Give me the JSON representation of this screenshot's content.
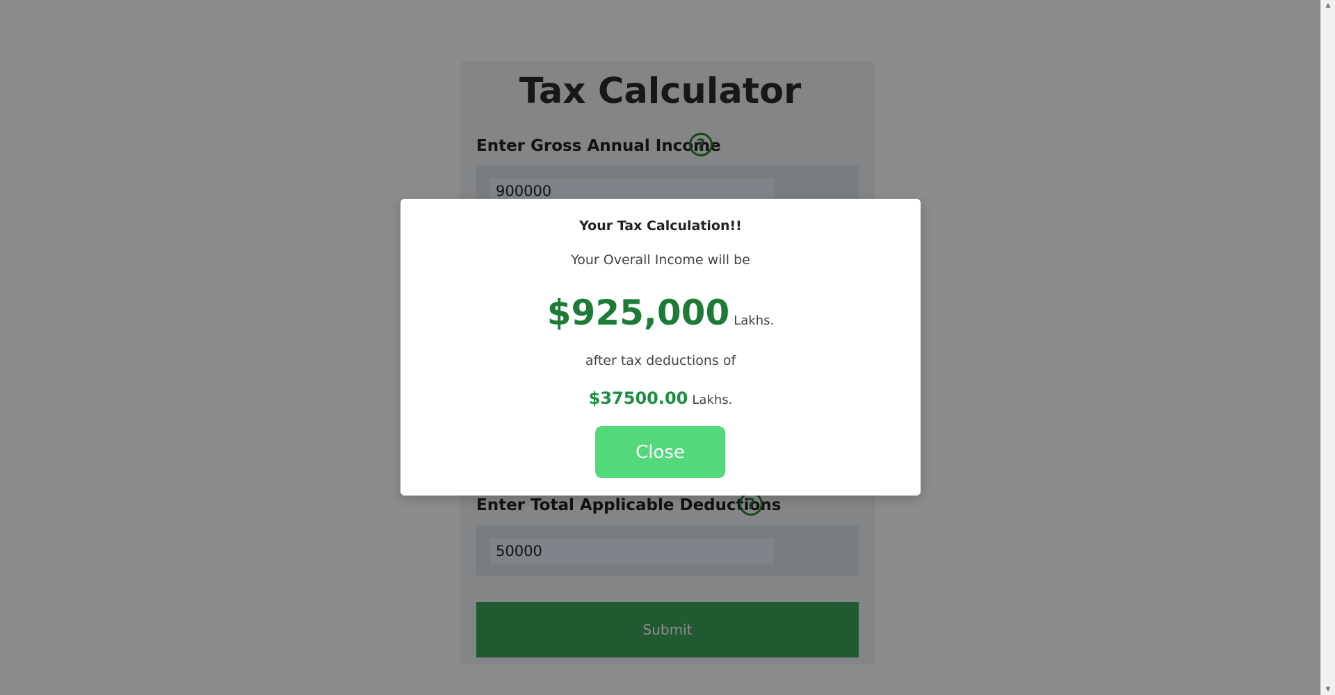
{
  "calculator": {
    "title": "Tax Calculator",
    "gross_income": {
      "label": "Enter Gross Annual Income",
      "help_icon": "question-icon",
      "value": "900000"
    },
    "deductions": {
      "label": "Enter Total Applicable Deductions",
      "help_icon": "question-icon",
      "value": "50000"
    },
    "submit_label": "Submit"
  },
  "modal": {
    "title": "Your Tax Calculation!!",
    "intro_text": "Your Overall Income will be",
    "overall_income": "$925,000",
    "overall_income_unit": "Lakhs.",
    "deduction_text": "after tax deductions of",
    "tax_deduction": "$37500.00",
    "tax_deduction_unit": "Lakhs.",
    "close_label": "Close"
  },
  "colors": {
    "accent_green": "#3da35a",
    "amount_green": "#1e7b37",
    "close_button": "#54d87c"
  }
}
